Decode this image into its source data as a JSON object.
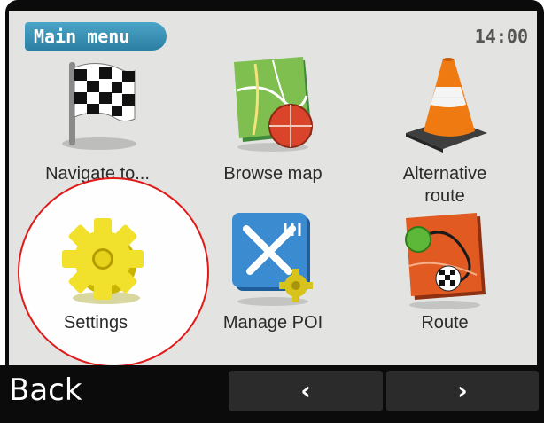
{
  "header": {
    "title": "Main menu",
    "time": "14:00"
  },
  "menu": {
    "items": [
      {
        "label": "Navigate to...",
        "icon": "checkered-flag-icon"
      },
      {
        "label": "Browse map",
        "icon": "map-icon"
      },
      {
        "label": "Alternative route",
        "icon": "traffic-cone-icon"
      },
      {
        "label": "Settings",
        "icon": "gear-icon",
        "highlighted": true
      },
      {
        "label": "Manage POI",
        "icon": "poi-cutlery-icon"
      },
      {
        "label": "Route",
        "icon": "route-map-icon"
      }
    ]
  },
  "footer": {
    "back_label": "Back",
    "prev_glyph": "‹",
    "next_glyph": "›"
  },
  "colors": {
    "accent": "#3a93b8",
    "highlight": "#e01a1a",
    "screen_bg": "#e3e3e1"
  }
}
